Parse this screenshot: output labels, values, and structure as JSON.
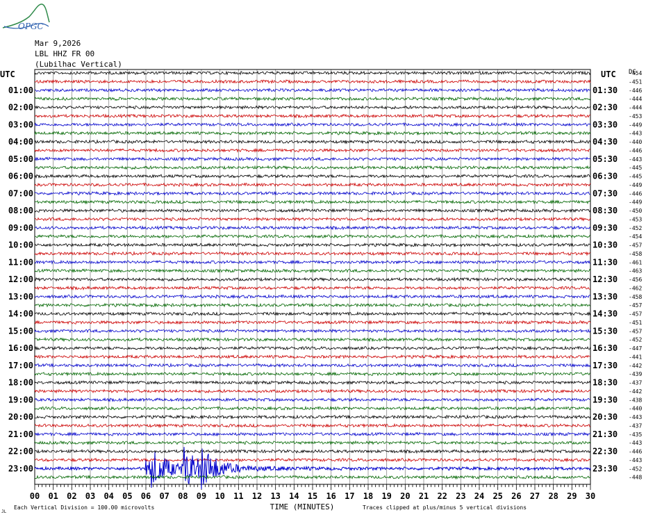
{
  "logo": {
    "text": "OPGC"
  },
  "header": {
    "date": "Mar 9,2026",
    "station": "LBL HHZ FR 00",
    "name": "(Lubilhac Vertical)"
  },
  "chart_data": {
    "type": "line",
    "title": "",
    "left_axis_title": "UTC",
    "right_axis_title": "UTC",
    "right_column_title": "DC",
    "xlabel": "TIME (MINUTES)",
    "xlim": [
      0,
      30
    ],
    "x_tick_labels": [
      "00",
      "01",
      "02",
      "03",
      "04",
      "05",
      "06",
      "07",
      "08",
      "09",
      "10",
      "11",
      "12",
      "13",
      "14",
      "15",
      "16",
      "17",
      "18",
      "19",
      "20",
      "21",
      "22",
      "23",
      "24",
      "25",
      "26",
      "27",
      "28",
      "29",
      "30"
    ],
    "left_row_labels": [
      "01:00",
      "02:00",
      "03:00",
      "04:00",
      "05:00",
      "06:00",
      "07:00",
      "08:00",
      "09:00",
      "10:00",
      "11:00",
      "12:00",
      "13:00",
      "14:00",
      "15:00",
      "16:00",
      "17:00",
      "18:00",
      "19:00",
      "20:00",
      "21:00",
      "22:00",
      "23:00"
    ],
    "right_row_labels": [
      "01:30",
      "02:30",
      "03:30",
      "04:30",
      "05:30",
      "06:30",
      "07:30",
      "08:30",
      "09:30",
      "10:30",
      "11:30",
      "12:30",
      "13:30",
      "14:30",
      "15:30",
      "16:30",
      "17:30",
      "18:30",
      "19:30",
      "20:30",
      "21:30",
      "22:30",
      "23:30"
    ],
    "trace_colors": [
      "#000000",
      "#cc0000",
      "#0000cc",
      "#006600"
    ],
    "dc_offsets": [
      -454,
      -451,
      -446,
      -444,
      -444,
      -453,
      -449,
      -443,
      -440,
      -446,
      -443,
      -445,
      -445,
      -449,
      -446,
      -449,
      -450,
      -453,
      -452,
      -454,
      -457,
      -458,
      -461,
      -463,
      -456,
      -462,
      -458,
      -457,
      -457,
      -451,
      -457,
      -452,
      -447,
      -441,
      -442,
      -439,
      -437,
      -442,
      -438,
      -440,
      -443,
      -437,
      -435,
      -443,
      -446,
      -443,
      -452,
      -448
    ],
    "event": {
      "start_minute": 6.0,
      "peak_minutes": [
        6.2,
        8.0,
        9.0
      ],
      "end_minute": 18.0,
      "row_index": 46
    },
    "footer_left": "Each Vertical Division =  100.00 microvolts",
    "footer_right": "Traces clipped at plus/minus 5 vertical divisions",
    "footer_corner": "JL"
  }
}
